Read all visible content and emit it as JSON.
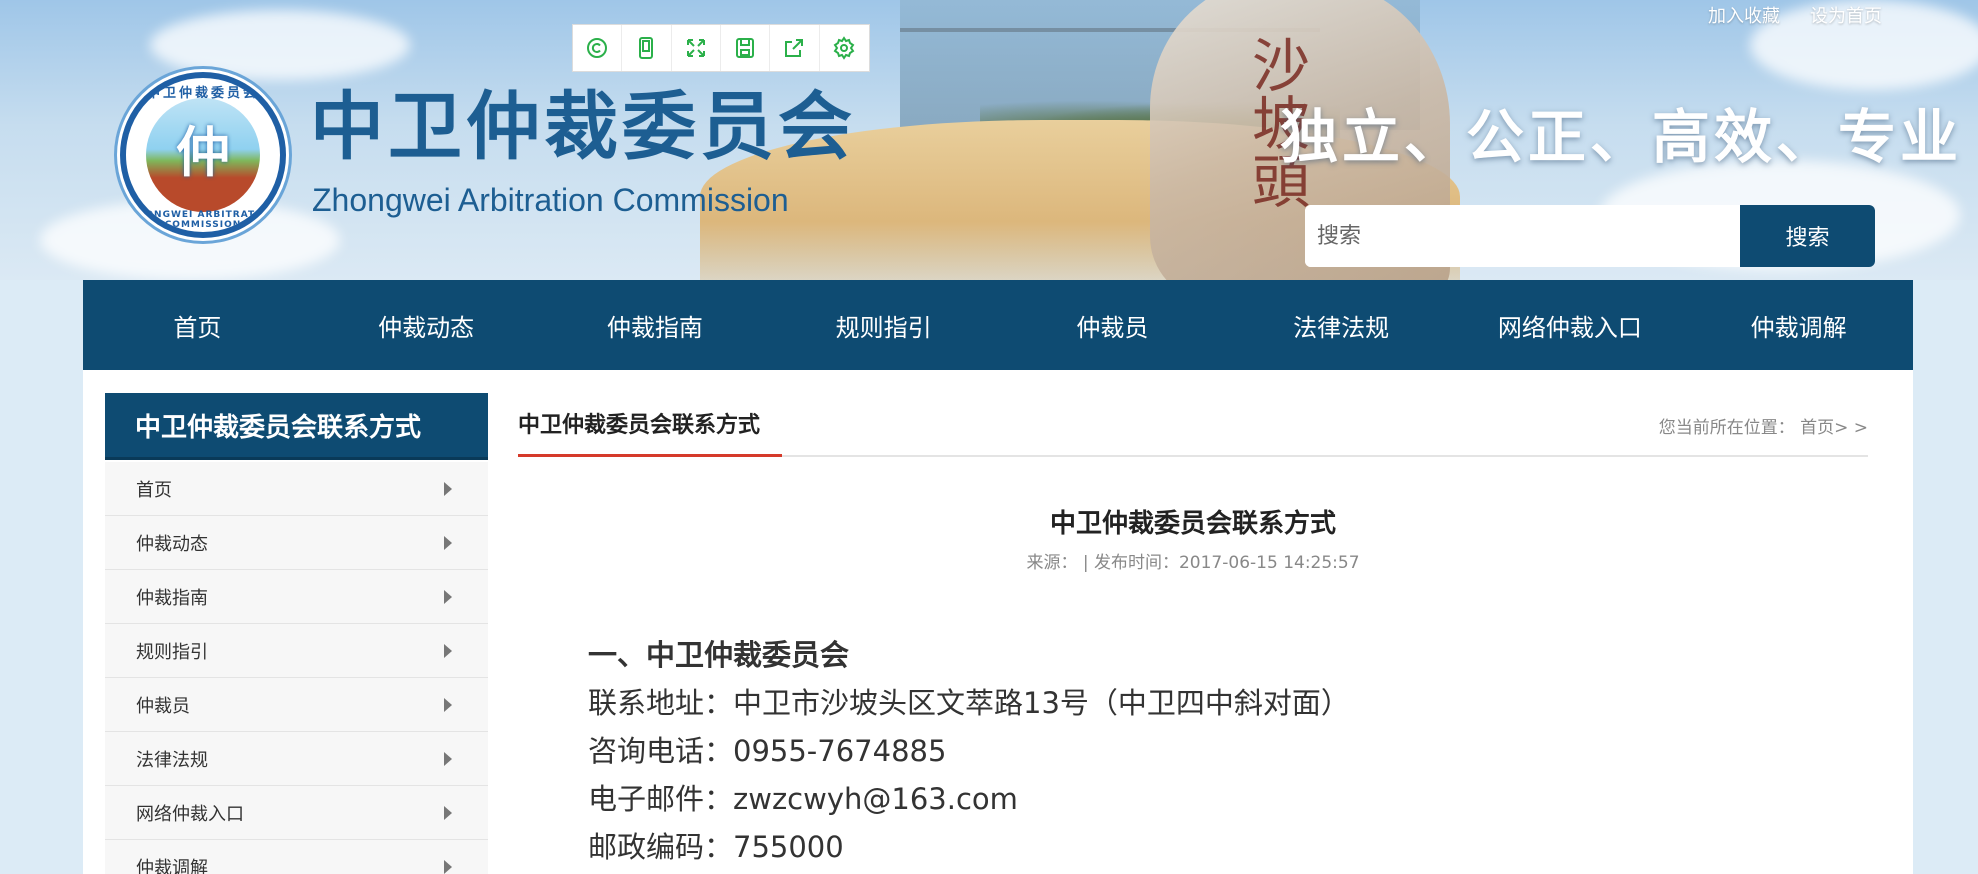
{
  "top_links": [
    "加入收藏",
    "设为首页"
  ],
  "toolbar": {
    "icons": [
      "accessibility-icon",
      "mobile-icon",
      "fullscreen-icon",
      "save-icon",
      "share-icon",
      "settings-icon"
    ],
    "icon_color": "#2bb04a"
  },
  "brand": {
    "title_cn": "中卫仲裁委员会",
    "title_en": "Zhongwei Arbitration Commission",
    "logo_ring_text": "中卫仲裁委员会",
    "logo_en_text": "ZHONGWEI ARBITRATION COMMISSION",
    "slogan": "独立、公正、高效、专业",
    "rock_text": "沙坡頭"
  },
  "search": {
    "placeholder": "搜索",
    "button_label": "搜索"
  },
  "nav": {
    "items": [
      "首页",
      "仲裁动态",
      "仲裁指南",
      "规则指引",
      "仲裁员",
      "法律法规",
      "网络仲裁入口",
      "仲裁调解"
    ]
  },
  "sidebar": {
    "title": "中卫仲裁委员会联系方式",
    "items": [
      "首页",
      "仲裁动态",
      "仲裁指南",
      "规则指引",
      "仲裁员",
      "法律法规",
      "网络仲裁入口",
      "仲裁调解"
    ]
  },
  "main": {
    "section_title": "中卫仲裁委员会联系方式",
    "breadcrumb": "您当前所在位置： 首页>  >",
    "article": {
      "title": "中卫仲裁委员会联系方式",
      "meta": "来源：   |  发布时间：2017-06-15 14:25:57",
      "section_heading": "一、中卫仲裁委员会",
      "address": "联系地址：中卫市沙坡头区文萃路13号（中卫四中斜对面）",
      "phone": "咨询电话：0955-7674885",
      "email": "电子邮件：zwzcwyh@163.com",
      "postcode": "邮政编码：755000"
    }
  },
  "colors": {
    "primary": "#0e4b72",
    "accent_red": "#d53a2a",
    "title_blue": "#1d5e92"
  }
}
